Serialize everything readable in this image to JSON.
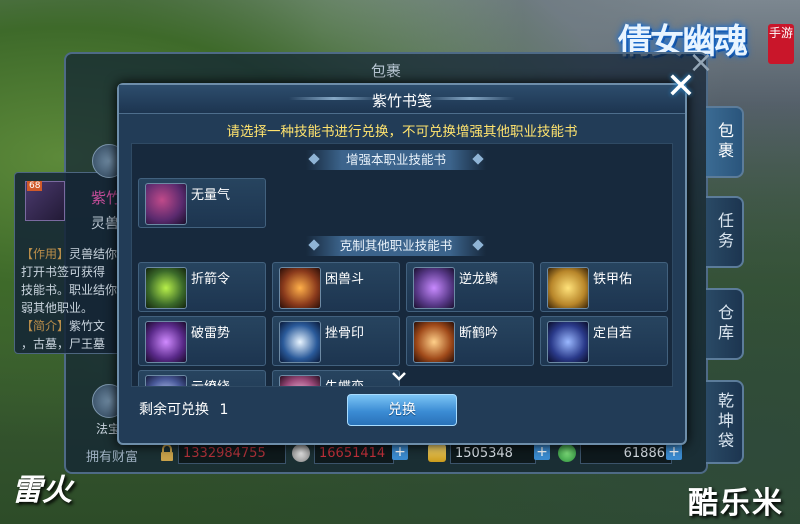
{
  "game": {
    "logo_text": "倩女幽魂",
    "logo_seal": "手游",
    "brand_left": "雷火",
    "brand_right": "酷乐米"
  },
  "bag": {
    "title": "包裹",
    "side_tabs": [
      {
        "label": "包裹",
        "active": true
      },
      {
        "label": "任务",
        "active": false
      },
      {
        "label": "仓库",
        "active": false
      },
      {
        "label": "乾坤袋",
        "active": false
      }
    ],
    "wealth_label": "拥有财富",
    "currencies": [
      {
        "value": "1332984755",
        "color": "#b0323a",
        "icon": "lock-icon"
      },
      {
        "value": "16651414",
        "color": "#c0303a",
        "icon": "coin-icon"
      },
      {
        "value": "1505348",
        "color": "#d8dfe6",
        "icon": "ingot-icon"
      },
      {
        "value": "61886",
        "color": "#d8dfe6",
        "icon": "jade-icon"
      }
    ],
    "item_detail": {
      "badge": "68",
      "name": "紫竹",
      "sub": "灵兽",
      "desc_label_1": "【作用】",
      "desc_text_1": "灵兽结你",
      "desc_line_2": "打开书签可获得",
      "desc_line_3": "技能书。职业结你",
      "desc_line_4": "弱其他职业。",
      "desc_label_2": "【简介】",
      "desc_text_2": "紫竹文",
      "desc_line_6": "，古墓，尸王墓"
    },
    "left_label": "法宝"
  },
  "dialog": {
    "title": "紫竹书笺",
    "notice": "请选择一种技能书进行兑换，不可兑换增强其他职业技能书",
    "section_own": "增强本职业技能书",
    "section_other": "克制其他职业技能书",
    "own_items": [
      {
        "name": "无量气",
        "icon": "wuliangqi-icon",
        "color": "#5a2a6e"
      }
    ],
    "other_items": [
      {
        "name": "折箭令",
        "icon": "arrow-break-icon",
        "color": "#3b6a2a"
      },
      {
        "name": "困兽斗",
        "icon": "beast-fight-icon",
        "color": "#8a3a1c"
      },
      {
        "name": "逆龙鳞",
        "icon": "dragon-scale-icon",
        "color": "#5a3a8a"
      },
      {
        "name": "铁甲佑",
        "icon": "iron-shield-icon",
        "color": "#b8862a"
      },
      {
        "name": "破雷势",
        "icon": "thunder-icon",
        "color": "#5a2a8a"
      },
      {
        "name": "挫骨印",
        "icon": "skull-icon",
        "color": "#2a5a9a"
      },
      {
        "name": "断鹤吟",
        "icon": "crane-icon",
        "color": "#a04a1a"
      },
      {
        "name": "定自若",
        "icon": "vortex-icon",
        "color": "#2a3a8a"
      },
      {
        "name": "云缭绕",
        "icon": "cloud-icon",
        "color": "#4a5a9a"
      },
      {
        "name": "失蝶恋",
        "icon": "butterfly-icon",
        "color": "#9a4a7a"
      }
    ],
    "remaining_label": "剩余可兑换",
    "remaining_count": "1",
    "exchange_button": "兑换"
  }
}
